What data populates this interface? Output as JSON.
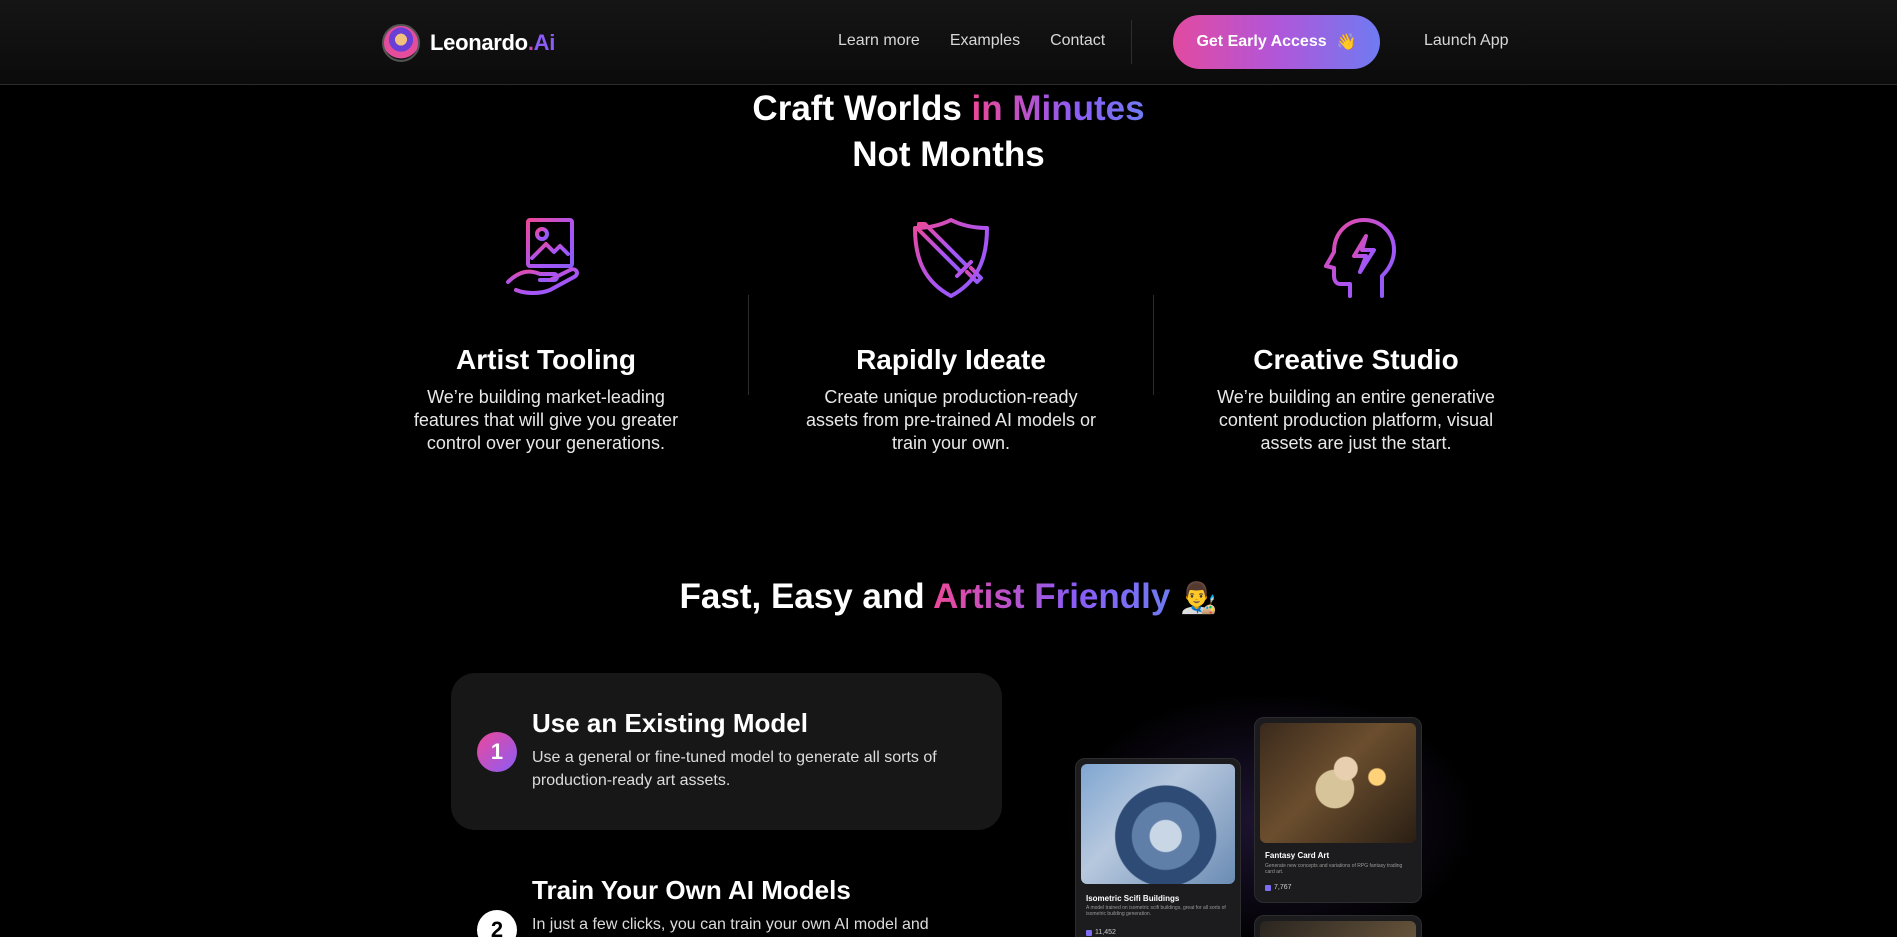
{
  "nav": {
    "brand": "Leonardo",
    "brand_dot": ".",
    "brand_ai": "Ai",
    "links": [
      "Learn more",
      "Examples",
      "Contact"
    ],
    "cta_label": "Get Early Access",
    "cta_emoji": "👋",
    "launch_label": "Launch App"
  },
  "hero": {
    "title_plain": "Craft Worlds ",
    "title_accent": "in Minutes",
    "title_line2": "Not Months"
  },
  "features": [
    {
      "icon": "image-hand-icon",
      "title": "Artist Tooling",
      "text": "We’re building market-leading features that will give you greater control over your generations."
    },
    {
      "icon": "sword-shield-icon",
      "title": "Rapidly Ideate",
      "text": "Create unique production-ready assets from pre-trained AI models or train your own."
    },
    {
      "icon": "head-lightning-icon",
      "title": "Creative Studio",
      "text": "We’re building an entire generative content production platform, visual assets are just the start."
    }
  ],
  "section2": {
    "title_plain": "Fast, Easy and ",
    "title_accent": "Artist Friendly",
    "emoji": "👨‍🎨"
  },
  "steps": [
    {
      "number": "1",
      "title": "Use an Existing Model",
      "text": "Use a general or fine-tuned model to generate all sorts of production-ready art assets."
    },
    {
      "number": "2",
      "title": "Train Your Own AI Models",
      "text": "In just a few clicks, you can train your own AI model and"
    }
  ],
  "cards": [
    {
      "title": "Isometric Scifi Buildings",
      "desc": "A model trained on isometric scifi buildings, great for all sorts of isometric building generation.",
      "likes": "11,452"
    },
    {
      "title": "Fantasy Card Art",
      "desc": "Generate new concepts and variations of RPG fantasy trading card art.",
      "likes": "7,767"
    }
  ],
  "colors": {
    "accent_pink": "#ec4899",
    "accent_purple": "#8b5cf6",
    "accent_blue": "#6f7bf2",
    "background": "#000000"
  }
}
